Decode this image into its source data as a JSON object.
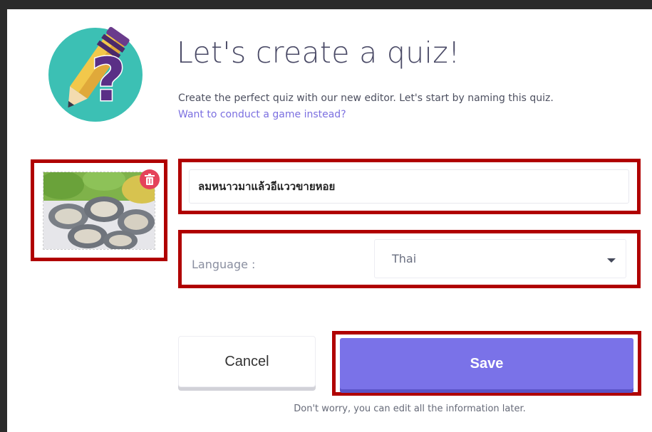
{
  "dialog": {
    "title": "Let's create a quiz!",
    "subtitle": "Create the perfect quiz with our new editor. Let's start by naming this quiz.",
    "subtitle_link": "Want to conduct a game instead?",
    "quiz_name": "ลมหนาวมาแล้วอีแววขายหอย",
    "language_label": "Language :",
    "language_value": "Thai",
    "cancel_label": "Cancel",
    "save_label": "Save",
    "footer_note": "Don't worry, you can edit all the information later."
  },
  "colors": {
    "accent": "#7a72e8",
    "delete": "#e5435a",
    "highlight": "#b00000",
    "logo_bg": "#3cc0b4"
  },
  "icons": {
    "logo": "quiz-pencil-question-logo",
    "delete": "trash-icon",
    "dropdown": "caret-down-icon"
  }
}
